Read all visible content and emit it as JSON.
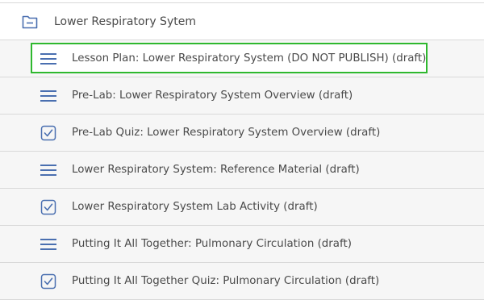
{
  "module": {
    "title": "Lower Respiratory Sytem",
    "icon": "folder-collapse-icon"
  },
  "items": [
    {
      "label": "Lesson Plan: Lower Respiratory System (DO NOT PUBLISH) (draft)",
      "icon": "page-lines-icon",
      "selected": true
    },
    {
      "label": "Pre-Lab: Lower Respiratory System Overview (draft)",
      "icon": "page-lines-icon",
      "selected": false
    },
    {
      "label": "Pre-Lab Quiz: Lower Respiratory System Overview (draft)",
      "icon": "quiz-check-icon",
      "selected": false
    },
    {
      "label": "Lower Respiratory System: Reference Material (draft)",
      "icon": "page-lines-icon",
      "selected": false
    },
    {
      "label": "Lower Respiratory System Lab Activity (draft)",
      "icon": "quiz-check-icon",
      "selected": false
    },
    {
      "label": "Putting It All Together: Pulmonary Circulation (draft)",
      "icon": "page-lines-icon",
      "selected": false
    },
    {
      "label": "Putting It All Together Quiz: Pulmonary Circulation (draft)",
      "icon": "quiz-check-icon",
      "selected": false
    }
  ],
  "colors": {
    "icon": "#4a6fb0",
    "text": "#4a4a4a",
    "selection": "#2fb82f",
    "row_bg": "#f6f6f6"
  }
}
